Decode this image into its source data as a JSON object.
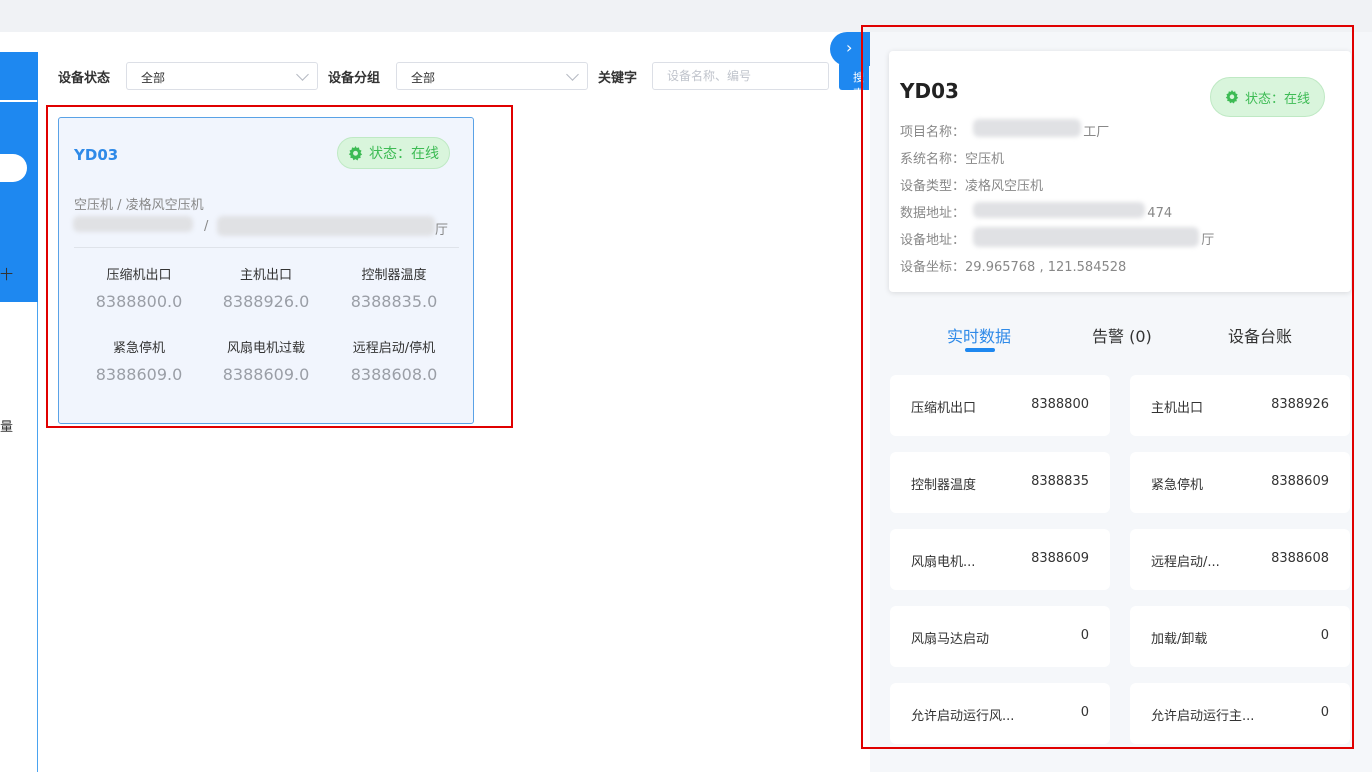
{
  "sidebar": {
    "char_1": "十",
    "char_2": "量"
  },
  "filters": {
    "status_label": "设备状态",
    "status_value": "全部",
    "group_label": "设备分组",
    "group_value": "全部",
    "keyword_label": "关键字",
    "keyword_placeholder": "设备名称、编号",
    "search_label": "搜索"
  },
  "card": {
    "title": "YD03",
    "status": "状态：在线",
    "subtitle": "空压机 / 凌格风空压机",
    "address_fragment_1": "/",
    "address_fragment_2": "厅",
    "metrics": [
      {
        "label": "压缩机出口",
        "value": "8388800.0"
      },
      {
        "label": "主机出口",
        "value": "8388926.0"
      },
      {
        "label": "控制器温度",
        "value": "8388835.0"
      },
      {
        "label": "紧急停机",
        "value": "8388609.0"
      },
      {
        "label": "风扇电机过载",
        "value": "8388609.0"
      },
      {
        "label": "远程启动/停机",
        "value": "8388608.0"
      }
    ]
  },
  "panel": {
    "collapse_icon": "›",
    "title": "YD03",
    "status": "状态：在线",
    "info": [
      {
        "label": "项目名称：",
        "value": "工厂"
      },
      {
        "label": "系统名称：",
        "value": "空压机"
      },
      {
        "label": "设备类型：",
        "value": "凌格风空压机"
      },
      {
        "label": "数据地址：",
        "value": "474"
      },
      {
        "label": "设备地址：",
        "value": "厅"
      },
      {
        "label": "设备坐标：",
        "value": "29.965768 , 121.584528"
      }
    ],
    "tabs": [
      "实时数据",
      "告警 (0)",
      "设备台账"
    ],
    "data": [
      {
        "label": "压缩机出口",
        "value": "8388800"
      },
      {
        "label": "主机出口",
        "value": "8388926"
      },
      {
        "label": "控制器温度",
        "value": "8388835"
      },
      {
        "label": "紧急停机",
        "value": "8388609"
      },
      {
        "label": "风扇电机...",
        "value": "8388609"
      },
      {
        "label": "远程启动/...",
        "value": "8388608"
      },
      {
        "label": "风扇马达启动",
        "value": "0"
      },
      {
        "label": "加载/卸载",
        "value": "0"
      },
      {
        "label": "允许启动运行风...",
        "value": "0"
      },
      {
        "label": "允许启动运行主...",
        "value": "0"
      }
    ]
  },
  "colors": {
    "accent": "#1e88f0",
    "online": "#3dbb54",
    "highlight": "#e00000"
  }
}
